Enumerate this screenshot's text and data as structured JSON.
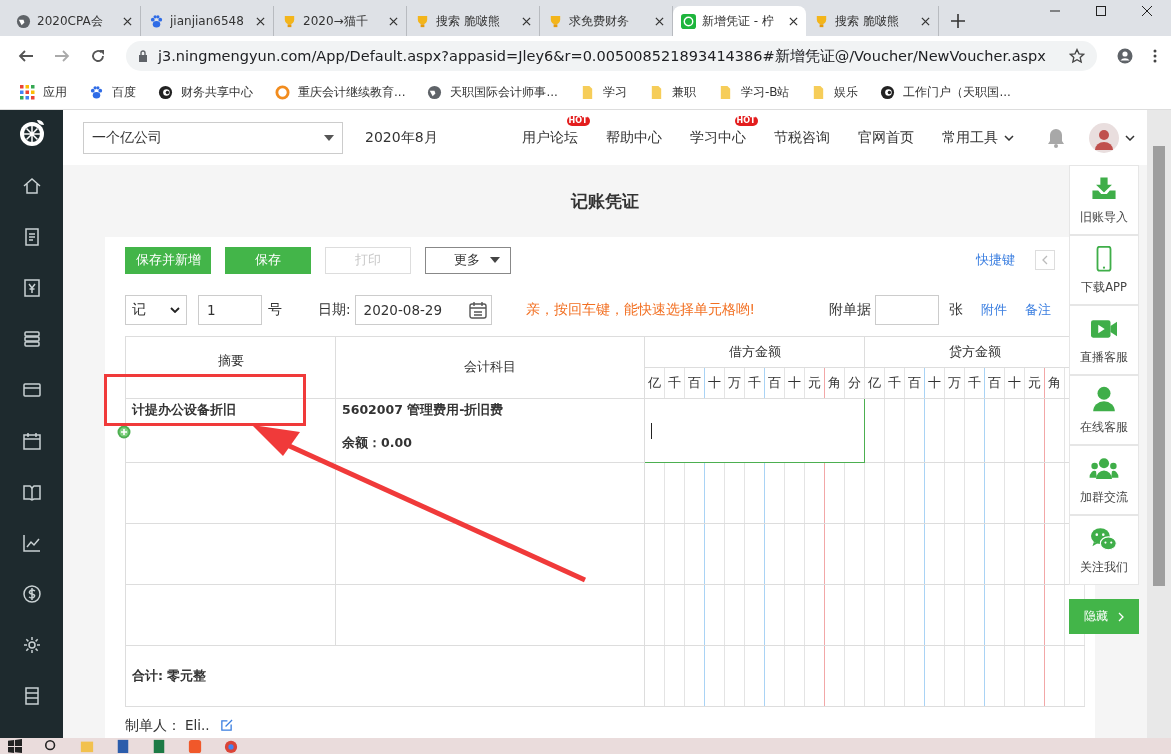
{
  "browser": {
    "tabs": [
      {
        "title": "2020CPA会",
        "kind": "globe",
        "selected": false
      },
      {
        "title": "jianjian6548",
        "kind": "paw",
        "selected": false
      },
      {
        "title": "2020→猫千",
        "kind": "trophy",
        "selected": false
      },
      {
        "title": "搜索 脆啵熊",
        "kind": "trophy",
        "selected": false
      },
      {
        "title": "求免费财务",
        "kind": "trophy",
        "selected": false
      },
      {
        "title": "新增凭证 - 柠",
        "kind": "lemon",
        "selected": true
      },
      {
        "title": "搜索 脆啵熊",
        "kind": "trophy",
        "selected": false
      }
    ],
    "url": "j3.ningmengyun.com/App/Default.aspx?appasid=Jley6&r=0.005008521893414386#新增凭证@/Voucher/NewVoucher.aspx",
    "bookmarks": [
      {
        "label": "应用",
        "kind": "apps"
      },
      {
        "label": "百度",
        "kind": "paw"
      },
      {
        "label": "财务共享中心",
        "kind": "swirl"
      },
      {
        "label": "重庆会计继续教育...",
        "kind": "ring"
      },
      {
        "label": "天职国际会计师事...",
        "kind": "globe"
      },
      {
        "label": "学习",
        "kind": "folder"
      },
      {
        "label": "兼职",
        "kind": "folder"
      },
      {
        "label": "学习-B站",
        "kind": "folder"
      },
      {
        "label": "娱乐",
        "kind": "folder"
      },
      {
        "label": "工作门户（天职国...",
        "kind": "swirl"
      }
    ]
  },
  "app": {
    "company": "一个亿公司",
    "period": "2020年8月",
    "nav": [
      {
        "label": "用户论坛",
        "badge": "HOT",
        "menu": false
      },
      {
        "label": "帮助中心",
        "menu": false
      },
      {
        "label": "学习中心",
        "badge": "HOT",
        "menu": false
      },
      {
        "label": "节税咨询",
        "menu": false
      },
      {
        "label": "官网首页",
        "menu": false
      },
      {
        "label": "常用工具",
        "menu": true
      }
    ]
  },
  "voucher": {
    "title": "记账凭证",
    "buttons": [
      {
        "label": "保存并新增",
        "kind": "primary"
      },
      {
        "label": "保存",
        "kind": "primary"
      },
      {
        "label": "打印",
        "kind": "disabled"
      },
      {
        "label": "更多",
        "kind": "dropdown"
      }
    ],
    "shortcut": "快捷键",
    "word": "记",
    "number": "1",
    "number_unit": "号",
    "date_label": "日期:",
    "date": "2020-08-29",
    "hint": "亲，按回车键，能快速选择单元格哟!",
    "attach_label": "附单据",
    "attach_unit": "张",
    "links": [
      "附件",
      "备注"
    ]
  },
  "table": {
    "headers": {
      "summary": "摘要",
      "account": "会计科目",
      "debit": "借方金额",
      "credit": "贷方金额"
    },
    "debit_digits": [
      "亿",
      "千",
      "百",
      "十",
      "万",
      "千",
      "百",
      "十",
      "元",
      "角",
      "分"
    ],
    "credit_digits": [
      "亿",
      "千",
      "百",
      "十",
      "万",
      "千",
      "百",
      "十",
      "元",
      "角"
    ],
    "rows": [
      {
        "summary": "计提办公设备折旧",
        "account": "5602007 管理费用-折旧费",
        "balance": "余额：0.00",
        "editing": true
      },
      {
        "editing": false
      },
      {
        "editing": false
      },
      {
        "editing": false
      }
    ],
    "total": "合计: 零元整"
  },
  "creator": {
    "label": "制单人：",
    "name": "Eli.."
  },
  "side_panel": {
    "items": [
      {
        "label": "旧账导入",
        "kind": "import"
      },
      {
        "label": "下载APP",
        "kind": "phone"
      },
      {
        "label": "直播客服",
        "kind": "video"
      },
      {
        "label": "在线客服",
        "kind": "person"
      },
      {
        "label": "加群交流",
        "kind": "group"
      },
      {
        "label": "关注我们",
        "kind": "chat"
      }
    ],
    "hide": "隐藏"
  }
}
